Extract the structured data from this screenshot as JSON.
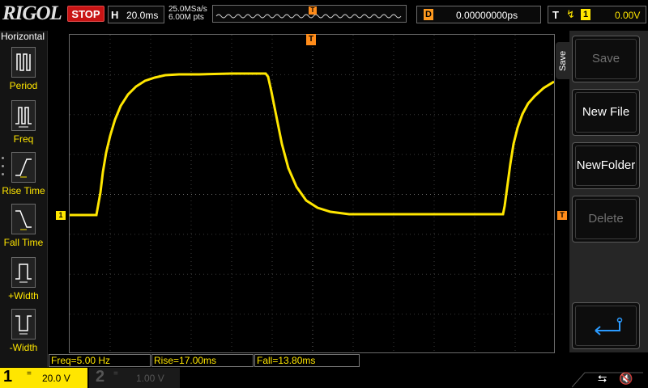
{
  "brand": "RIGOL",
  "run_state": "STOP",
  "horizontal": {
    "label": "H",
    "timebase": "20.0ms"
  },
  "acquisition": {
    "sample_rate": "25.0MSa/s",
    "memory_depth": "6.00M pts"
  },
  "delay": {
    "label": "D",
    "value": "0.00000000ps"
  },
  "trigger": {
    "label": "T",
    "source": "1",
    "level": "0.00V",
    "marker": "T"
  },
  "left_menu": {
    "title": "Horizontal",
    "items": [
      {
        "label": "Period",
        "icon": "period-icon"
      },
      {
        "label": "Freq",
        "icon": "frequency-icon"
      },
      {
        "label": "Rise Time",
        "icon": "rise-time-icon"
      },
      {
        "label": "Fall Time",
        "icon": "fall-time-icon"
      },
      {
        "label": "+Width",
        "icon": "positive-width-icon"
      },
      {
        "label": "-Width",
        "icon": "negative-width-icon"
      }
    ]
  },
  "right_menu": {
    "tab": "Save",
    "buttons": [
      {
        "label": "Save",
        "enabled": false
      },
      {
        "label": "New File",
        "enabled": true
      },
      {
        "label": "NewFolder",
        "enabled": true
      },
      {
        "label": "Delete",
        "enabled": false
      },
      {
        "label": "",
        "icon": "return-arrow-icon",
        "enabled": true
      }
    ]
  },
  "measurements": [
    {
      "label": "Freq=5.00 Hz"
    },
    {
      "label": "Rise=17.00ms"
    },
    {
      "label": "Fall=13.80ms"
    }
  ],
  "channels": [
    {
      "num": "1",
      "coupling": "=",
      "scale": "20.0 V",
      "active": true
    },
    {
      "num": "2",
      "coupling": "=",
      "scale": "1.00 V",
      "active": false
    }
  ],
  "channel_marker": "1",
  "status_icons": [
    "usb-icon",
    "speaker-muted-icon"
  ],
  "colors": {
    "ch1": "#ffe600",
    "trigger": "#ff8c1a",
    "stop": "#c81414"
  }
}
